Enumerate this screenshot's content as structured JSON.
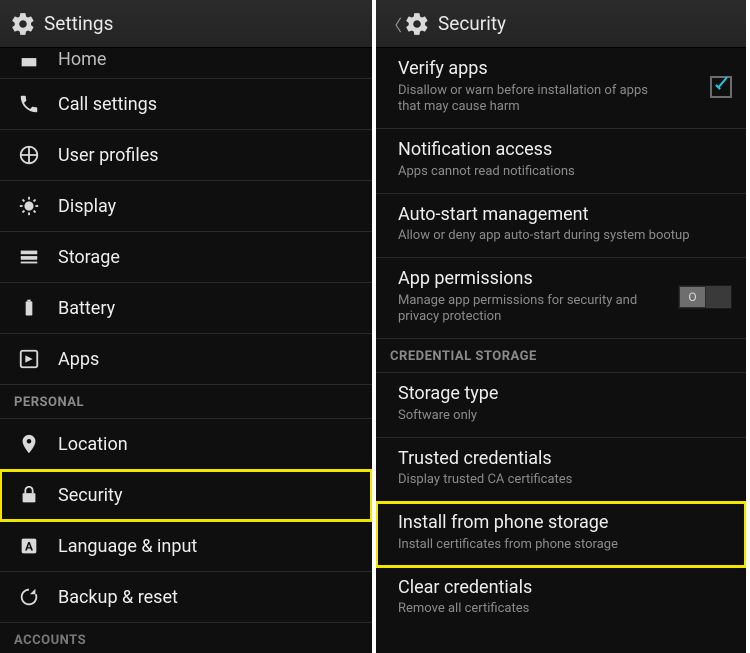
{
  "left": {
    "header_title": "Settings",
    "items": {
      "home": {
        "label": "Home"
      },
      "call": {
        "label": "Call settings"
      },
      "user_profiles": {
        "label": "User profiles"
      },
      "display": {
        "label": "Display"
      },
      "storage": {
        "label": "Storage"
      },
      "battery": {
        "label": "Battery"
      },
      "apps": {
        "label": "Apps"
      }
    },
    "section_personal": "PERSONAL",
    "personal": {
      "location": {
        "label": "Location"
      },
      "security": {
        "label": "Security"
      },
      "language": {
        "label": "Language & input"
      },
      "backup": {
        "label": "Backup & reset"
      }
    },
    "section_accounts": "ACCOUNTS"
  },
  "right": {
    "header_title": "Security",
    "verify": {
      "title": "Verify apps",
      "subtitle": "Disallow or warn before installation of apps that may cause harm",
      "checked": true
    },
    "notif": {
      "title": "Notification access",
      "subtitle": "Apps cannot read notifications"
    },
    "autostart": {
      "title": "Auto-start management",
      "subtitle": "Allow or deny app auto-start during system bootup"
    },
    "appperm": {
      "title": "App permissions",
      "subtitle": "Manage app permissions for security and privacy protection",
      "switch_label": "O"
    },
    "section_cred": "CREDENTIAL STORAGE",
    "storagetype": {
      "title": "Storage type",
      "subtitle": "Software only"
    },
    "trusted": {
      "title": "Trusted credentials",
      "subtitle": "Display trusted CA certificates"
    },
    "install": {
      "title": "Install from phone storage",
      "subtitle": "Install certificates from phone storage"
    },
    "clear": {
      "title": "Clear credentials",
      "subtitle": "Remove all certificates"
    }
  }
}
